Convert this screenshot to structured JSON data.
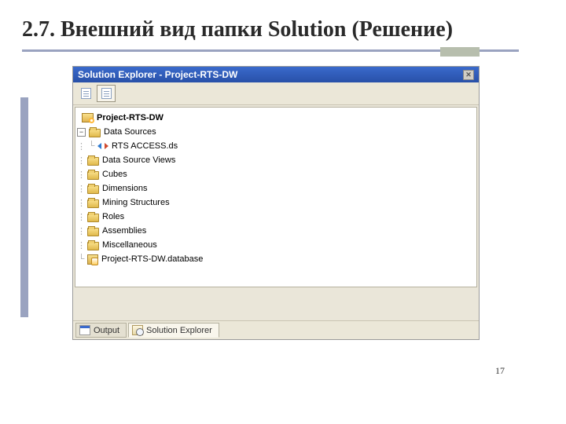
{
  "slide": {
    "title": "2.7. Внешний вид папки Solution (Решение)",
    "page_number": "17"
  },
  "window": {
    "title": "Solution Explorer - Project-RTS-DW"
  },
  "tree": {
    "root": "Project-RTS-DW",
    "data_sources": "Data Sources",
    "rts_access": "RTS ACCESS.ds",
    "data_source_views": "Data Source Views",
    "cubes": "Cubes",
    "dimensions": "Dimensions",
    "mining_structures": "Mining Structures",
    "roles": "Roles",
    "assemblies": "Assemblies",
    "miscellaneous": "Miscellaneous",
    "database_file": "Project-RTS-DW.database"
  },
  "tabs": {
    "output": "Output",
    "solution_explorer": "Solution Explorer"
  }
}
